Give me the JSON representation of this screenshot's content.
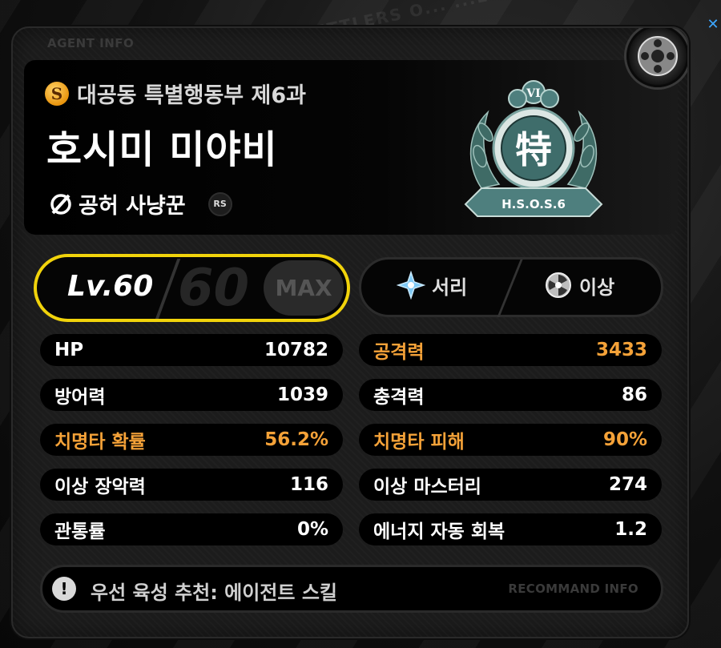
{
  "background": {
    "watermark": "...OU SETTLERS O... ...LOW"
  },
  "panel": {
    "label": "AGENT INFO"
  },
  "header": {
    "faction_badge": "S",
    "faction": "대공동 특별행동부 제6과",
    "agent_name": "호시미 미야비",
    "specialty": "공허 사냥꾼",
    "rank": "RS",
    "emblem": {
      "top": "VI",
      "center": "特",
      "ribbon": "H.S.O.S.6"
    }
  },
  "level": {
    "label": "Lv.60",
    "big": "60",
    "max_label": "MAX"
  },
  "attributes": {
    "element": "서리",
    "type": "이상"
  },
  "stats_left": [
    {
      "label": "HP",
      "value": "10782",
      "highlight": false
    },
    {
      "label": "방어력",
      "value": "1039",
      "highlight": false
    },
    {
      "label": "치명타 확률",
      "value": "56.2%",
      "highlight": true
    },
    {
      "label": "이상 장악력",
      "value": "116",
      "highlight": false
    },
    {
      "label": "관통률",
      "value": "0%",
      "highlight": false
    }
  ],
  "stats_right": [
    {
      "label": "공격력",
      "value": "3433",
      "highlight": true
    },
    {
      "label": "충격력",
      "value": "86",
      "highlight": false
    },
    {
      "label": "치명타 피해",
      "value": "90%",
      "highlight": true
    },
    {
      "label": "이상 마스터리",
      "value": "274",
      "highlight": false
    },
    {
      "label": "에너지 자동 회복",
      "value": "1.2",
      "highlight": false
    }
  ],
  "recommend": {
    "icon": "!",
    "text": "우선 육성 추천: 에이전트 스킬",
    "label": "RECOMMAND INFO"
  },
  "colors": {
    "accent_yellow": "#f1d30b",
    "highlight_orange": "#f5a238",
    "emblem_teal": "#4e7f7e"
  }
}
